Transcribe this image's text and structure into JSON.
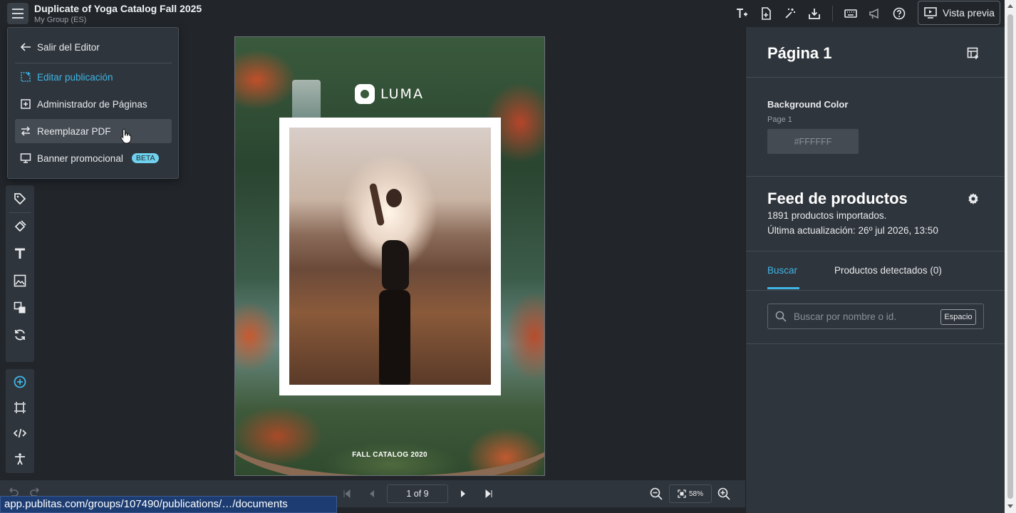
{
  "header": {
    "title": "Duplicate of Yoga Catalog Fall 2025",
    "subtitle": "My Group (ES)",
    "preview_label": "Vista previa"
  },
  "menu": {
    "items": [
      {
        "label": "Salir del Editor",
        "icon": "arrow-left-icon"
      },
      {
        "label": "Editar publicación",
        "icon": "edit-publication-icon"
      },
      {
        "label": "Administrador de Páginas",
        "icon": "page-manager-icon"
      },
      {
        "label": "Reemplazar PDF",
        "icon": "swap-icon"
      },
      {
        "label": "Banner promocional",
        "icon": "monitor-icon",
        "badge": "BETA"
      }
    ]
  },
  "canvas": {
    "logo_text": "LUMA",
    "catalog_label": "FALL CATALOG 2020"
  },
  "pagination": {
    "current": "1 of 9",
    "zoom": "58%"
  },
  "status_url": "app.publitas.com/groups/107490/publications/…/documents",
  "panel": {
    "page_title": "Página 1",
    "background": {
      "label": "Background Color",
      "sub": "Page 1",
      "value": "#FFFFFF"
    },
    "feed": {
      "title": "Feed de productos",
      "count_text": "1891 productos importados.",
      "updated_text": "Última actualización: 26º jul 2026, 13:50"
    },
    "tabs": [
      {
        "label": "Buscar",
        "active": true
      },
      {
        "label": "Productos detectados (0)",
        "active": false
      }
    ],
    "search": {
      "placeholder": "Buscar por nombre o id.",
      "shortcut": "Espacio"
    }
  },
  "colors": {
    "accent": "#3fb6e6",
    "background": "#22262b",
    "panel": "#2f353c"
  }
}
